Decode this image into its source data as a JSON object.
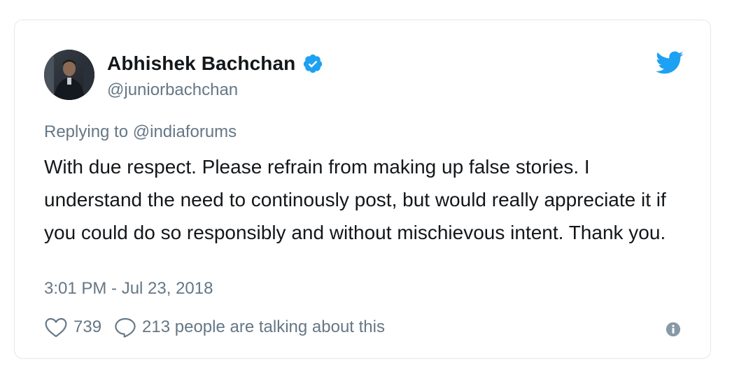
{
  "tweet": {
    "author_name": "Abhishek Bachchan",
    "author_handle": "@juniorbachchan",
    "verified": true,
    "reply_prefix": "Replying to",
    "reply_to": "@indiaforums",
    "text": "With due respect. Please refrain from making up false stories. I understand the need to continously post, but would really appreciate it if you could do so responsibly and without mischievous intent. Thank you.",
    "timestamp": "3:01 PM - Jul 23, 2018",
    "likes": "739",
    "conversation": "213 people are talking about this"
  },
  "icons": {
    "avatar": "avatar",
    "verified": "verified-badge-icon",
    "brand": "twitter-bird-icon",
    "like": "heart-icon",
    "reply": "speech-bubble-icon",
    "info": "info-icon"
  },
  "colors": {
    "brand": "#1da1f2",
    "text": "#14171a",
    "secondary": "#657786",
    "border": "#e1e8ed"
  }
}
